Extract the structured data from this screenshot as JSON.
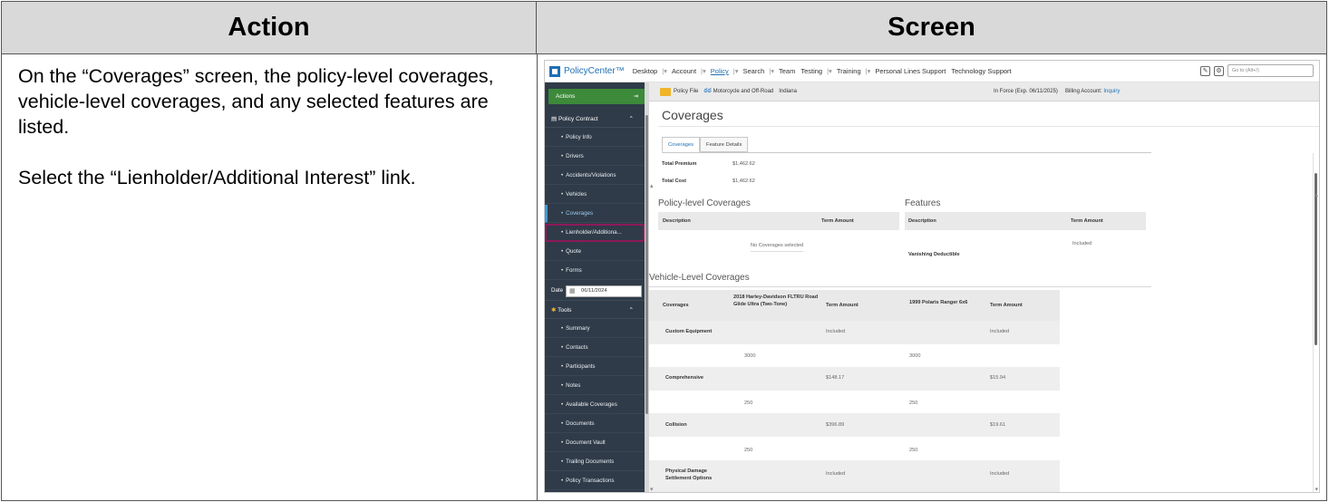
{
  "header": {
    "action_label": "Action",
    "screen_label": "Screen"
  },
  "action": {
    "para1": "On the “Coverages” screen, the policy-level coverages, vehicle-level coverages, and any selected features are listed.",
    "para2": "Select the “Lienholder/Additional Interest” link."
  },
  "app": {
    "brand": "PolicyCenter™",
    "nav": [
      "Desktop",
      "Account",
      "Policy",
      "Search",
      "Team",
      "Testing",
      "Training",
      "Personal Lines Support",
      "Technology Support"
    ],
    "goto_placeholder": "Go to (Alt+/)"
  },
  "sidebar": {
    "actions_label": "Actions",
    "policy_contract_label": "Policy Contract",
    "contract_items": [
      "Policy Info",
      "Drivers",
      "Accidents/Violations",
      "Vehicles",
      "Coverages",
      "Lienholder/Additiona...",
      "Quote",
      "Forms"
    ],
    "date_label": "Date",
    "date_value": "06/11/2024",
    "tools_label": "Tools",
    "tool_items": [
      "Summary",
      "Contacts",
      "Participants",
      "Notes",
      "Available Coverages",
      "Documents",
      "Document Vault",
      "Trailing Documents",
      "Policy Transactions"
    ]
  },
  "infobar": {
    "policy_file": "Policy File",
    "line": "Motorcycle and Off-Road",
    "state": "Indiana",
    "status": "In Force (Exp. 06/11/2025)",
    "billing_label": "Billing Account:",
    "billing_link": "Inquiry"
  },
  "main": {
    "title": "Coverages",
    "tabs": [
      "Coverages",
      "Feature Details"
    ],
    "total_premium_label": "Total Premium",
    "total_premium_value": "$1,462.62",
    "total_cost_label": "Total Cost",
    "total_cost_value": "$1,462.62",
    "policy_level_title": "Policy-level Coverages",
    "features_title": "Features",
    "pl_headers": [
      "Description",
      "Term Amount"
    ],
    "pl_empty": "No Coverages selected",
    "feat_headers": [
      "Description",
      "Term Amount"
    ],
    "feat_row": [
      "Vanishing Deductible",
      "Included"
    ],
    "vehicle_level_title": "Vehicle-Level Coverages",
    "vl_headers": [
      "Coverages",
      "2018 Harley-Davidson FLTRU Road Glide Ultra (Two-Tone)",
      "Term Amount",
      "1999 Polaris Ranger 6x6",
      "Term Amount"
    ],
    "vl_rows": [
      {
        "name": "Custom Equipment",
        "v1_amt": "Included",
        "v1_limit": "3000",
        "v2_amt": "Included",
        "v2_limit": "3000"
      },
      {
        "name": "Comprehensive",
        "v1_amt": "$148.17",
        "v1_limit": "250",
        "v2_amt": "$15.94",
        "v2_limit": "250"
      },
      {
        "name": "Collision",
        "v1_amt": "$396.89",
        "v1_limit": "250",
        "v2_amt": "$19.61",
        "v2_limit": "250"
      },
      {
        "name": "Physical Damage Settlement Options",
        "v1_amt": "Included",
        "v1_limit": "",
        "v2_amt": "Included",
        "v2_limit": ""
      }
    ]
  },
  "colors": {
    "sidebar_bg": "#2f3b48",
    "actions_green": "#3c8a3a",
    "link_blue": "#1f6fb5",
    "highlight": "#8b1a5a"
  }
}
